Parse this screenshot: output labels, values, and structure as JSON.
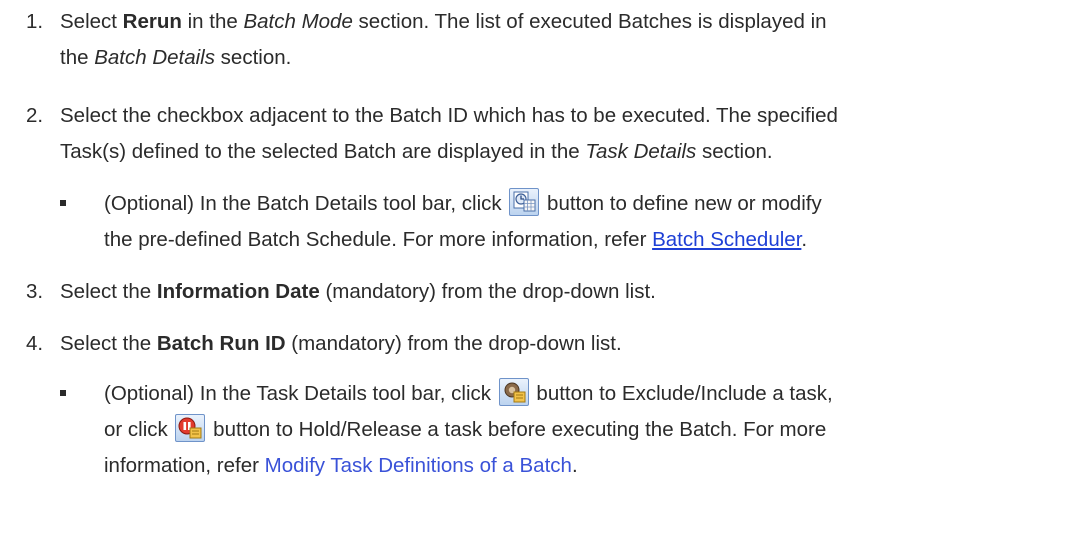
{
  "steps": [
    {
      "number": "1.",
      "parts": [
        "Select ",
        "Rerun",
        " in the ",
        "Batch Mode",
        " section. The list of executed Batches is displayed in",
        "the ",
        "Batch Details",
        " section."
      ]
    },
    {
      "number": "2.",
      "line1": "Select the checkbox adjacent to the Batch ID which has to be executed. The specified",
      "parts": [
        "Task(s) defined to the selected Batch are displayed in the ",
        "Task Details",
        " section."
      ]
    },
    {
      "number": "3.",
      "parts": [
        "Select the ",
        "Information Date",
        " (mandatory) from the drop-down list."
      ]
    },
    {
      "number": "4.",
      "parts": [
        "Select the ",
        "Batch Run ID",
        " (mandatory) from the drop-down list."
      ]
    }
  ],
  "bullet1": {
    "pre": "(Optional) In the Batch Details tool bar, click ",
    "post": " button to define new or modify",
    "line2_pre": "the pre-defined Batch Schedule. For more information, refer ",
    "link": "Batch Scheduler",
    "line2_post": ".",
    "icon": "batch-schedule-icon"
  },
  "bullet2": {
    "pre": "(Optional) In the Task Details tool bar, click ",
    "post": " button to Exclude/Include a task,",
    "line2_pre": "or click ",
    "line2_post": " button to Hold/Release a task before executing the Batch. For more",
    "line3_pre": "information, refer ",
    "link": "Modify Task Definitions of a Batch",
    "line3_post": ".",
    "icon1": "exclude-include-task-icon",
    "icon2": "hold-release-task-icon"
  },
  "colors": {
    "text": "#2b2b2b",
    "link_underlined": "#1e3fd6",
    "link": "#3a52d8",
    "button_border": "#6f93c9"
  }
}
